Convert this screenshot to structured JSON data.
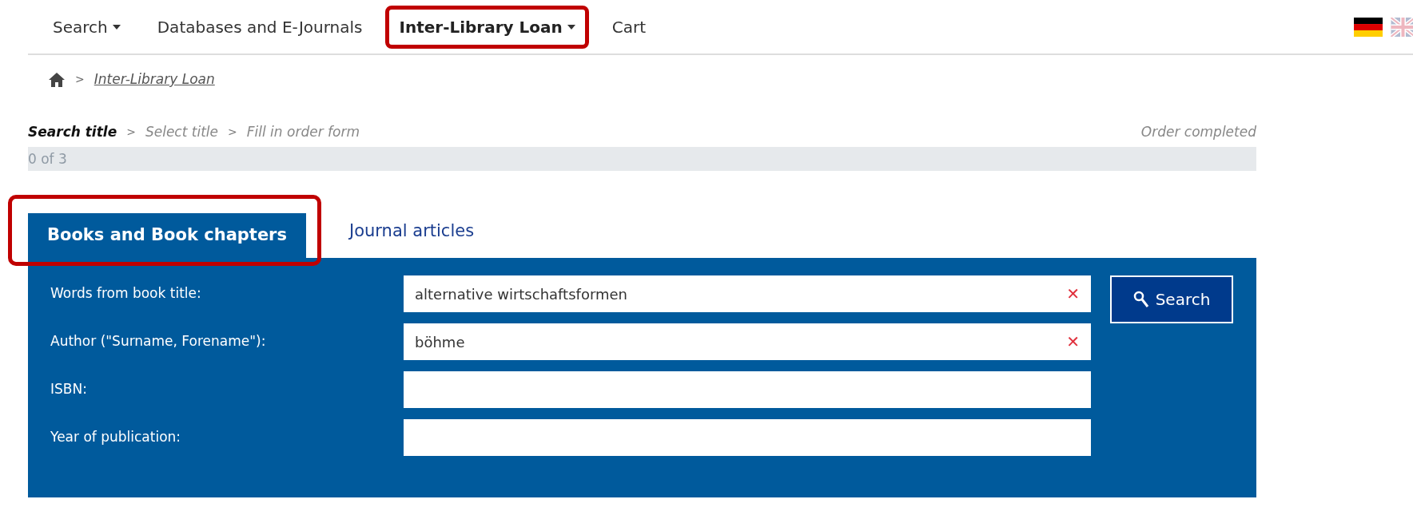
{
  "nav": {
    "items": [
      {
        "label": "Search",
        "dropdown": true,
        "selected": false,
        "highlighted": false
      },
      {
        "label": "Databases and E-Journals",
        "dropdown": false,
        "selected": false,
        "highlighted": false
      },
      {
        "label": "Inter-Library Loan",
        "dropdown": true,
        "selected": true,
        "highlighted": true
      },
      {
        "label": "Cart",
        "dropdown": false,
        "selected": false,
        "highlighted": false
      }
    ],
    "languages": [
      {
        "kind": "de",
        "selected": true
      },
      {
        "kind": "en",
        "selected": false
      }
    ]
  },
  "breadcrumb": {
    "separator": ">",
    "items": [
      "Inter-Library Loan"
    ]
  },
  "steps": {
    "items": [
      {
        "label": "Search title",
        "selected": true
      },
      {
        "label": "Select title",
        "selected": false
      },
      {
        "label": "Fill in order form",
        "selected": false
      }
    ],
    "separator": ">",
    "end_label": "Order completed",
    "progress": {
      "label": "0 of 3",
      "level": 0
    }
  },
  "tabs": [
    {
      "label": "Books and Book chapters",
      "selected": true,
      "highlighted": true
    },
    {
      "label": "Journal articles",
      "selected": false,
      "highlighted": false
    }
  ],
  "form": {
    "fields": [
      {
        "label": "Words from book title:",
        "value": "alternative wirtschaftsformen",
        "clearable": true
      },
      {
        "label": "Author (\"Surname, Forename\"):",
        "value": "böhme",
        "clearable": true
      },
      {
        "label": "ISBN:",
        "clearable": false
      },
      {
        "label": "Year of publication:",
        "clearable": false
      }
    ],
    "clear_symbol": "✕",
    "search_button": "Search"
  }
}
